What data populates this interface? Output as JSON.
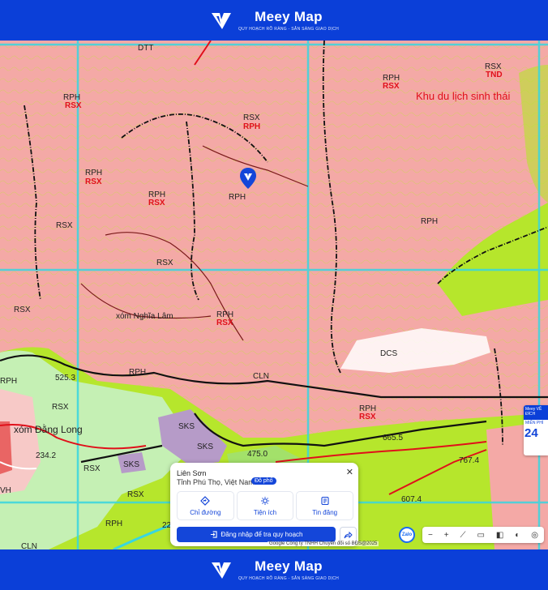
{
  "header": {
    "brand": "Meey Map",
    "tagline": "QUY HOẠCH RÕ RÀNG - SẴN SÀNG GIAO DỊCH"
  },
  "footer": {
    "brand": "Meey Map",
    "tagline": "QUY HOẠCH RÕ RÀNG - SẴN SÀNG GIAO DỊCH"
  },
  "map": {
    "labels": {
      "dtt": "DTT",
      "rph_a": "RPH",
      "rsx_a": "RSX",
      "rsx_tnd": "RSX",
      "tnd": "TND",
      "rph_b": "RPH",
      "rsx_b": "RSX",
      "tourism": "Khu du lịch sinh thái",
      "rsx_c": "RSX",
      "rph_c": "RPH",
      "rph_d": "RPH",
      "rsx_d": "RSX",
      "rph_e": "RPH",
      "rsx_e": "RSX",
      "rph_pin": "RPH",
      "rsx_f": "RSX",
      "rph_big": "RPH",
      "rsx_g": "RSX",
      "rsx_h": "RSX",
      "hamlet_nghia_lam": "xóm Nghĩa Lâm",
      "rph_f": "RPH",
      "rsx_i": "RSX",
      "dcs": "DCS",
      "rph_g": "RPH",
      "cln_a": "CLN",
      "elev_525": "525.3",
      "rph_h": "RPH",
      "rsx_j": "RSX",
      "hamlet_dang_long": "xóm Đằng Long",
      "sks_a": "SKS",
      "sks_b": "SKS",
      "sks_c": "SKS",
      "elev_234": "234.2",
      "rsx_k": "RSX",
      "rph_i": "RPH",
      "rsx_l": "RSX",
      "elev_665": "665.5",
      "elev_475": "475.0",
      "elev_767": "767.4",
      "elev_607": "607.4",
      "vh": "VH",
      "rsx_m": "RSX",
      "rph_j": "RPH",
      "cln_b": "CLN",
      "elev_22": "22"
    }
  },
  "card": {
    "place": "Liên Sơn",
    "region": "Tỉnh Phú Thọ, Việt Nam",
    "badge": "Đô phố",
    "actions": {
      "directions": "Chỉ đường",
      "amenities": "Tiện ích",
      "news": "Tin đăng"
    },
    "login": "Đăng nhập để tra quy hoạch"
  },
  "attribution": "Google  Công ty TNHH Chuyển đổi số BĐS@2025",
  "zalo": "Zalo",
  "promo": {
    "top": "Meey VỀ ĐÍCH",
    "mid": "MIỄN PHÍ",
    "num": "24"
  },
  "colors": {
    "brand": "#0b3fd8",
    "pink": "#f4a9a6",
    "lime": "#b6e62c",
    "mint": "#c5f0b4"
  }
}
